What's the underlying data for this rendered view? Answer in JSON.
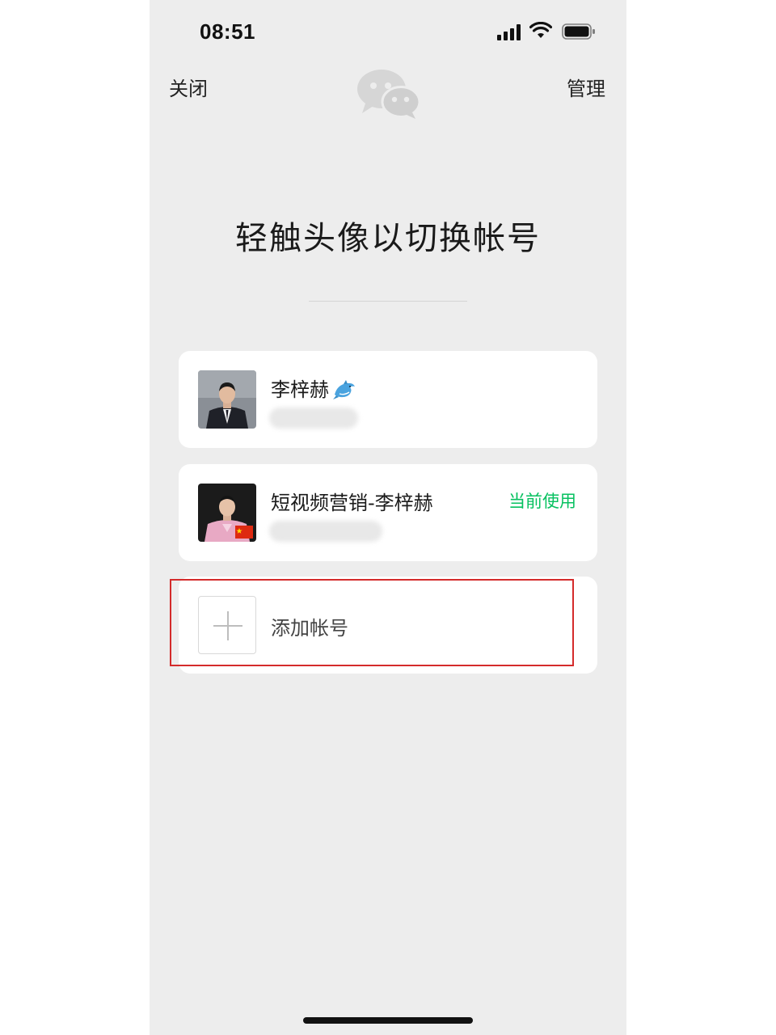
{
  "status_bar": {
    "time": "08:51",
    "icons": [
      "signal-icon",
      "wifi-icon",
      "battery-icon"
    ]
  },
  "nav": {
    "close_label": "关闭",
    "manage_label": "管理",
    "logo": "wechat-logo-icon"
  },
  "headline": "轻触头像以切换帐号",
  "accounts": [
    {
      "name": "李梓赫",
      "name_icon": "dolphin-icon",
      "id_obscured": true,
      "current": false
    },
    {
      "name": "短视频营销-李梓赫",
      "avatar_badge": "china-flag-icon",
      "id_obscured": true,
      "current": true,
      "current_label": "当前使用"
    }
  ],
  "add_account": {
    "label": "添加帐号",
    "icon": "plus-icon"
  },
  "colors": {
    "background": "#ededed",
    "card": "#ffffff",
    "accent_green": "#07c160",
    "highlight_red": "#d42b2b"
  }
}
